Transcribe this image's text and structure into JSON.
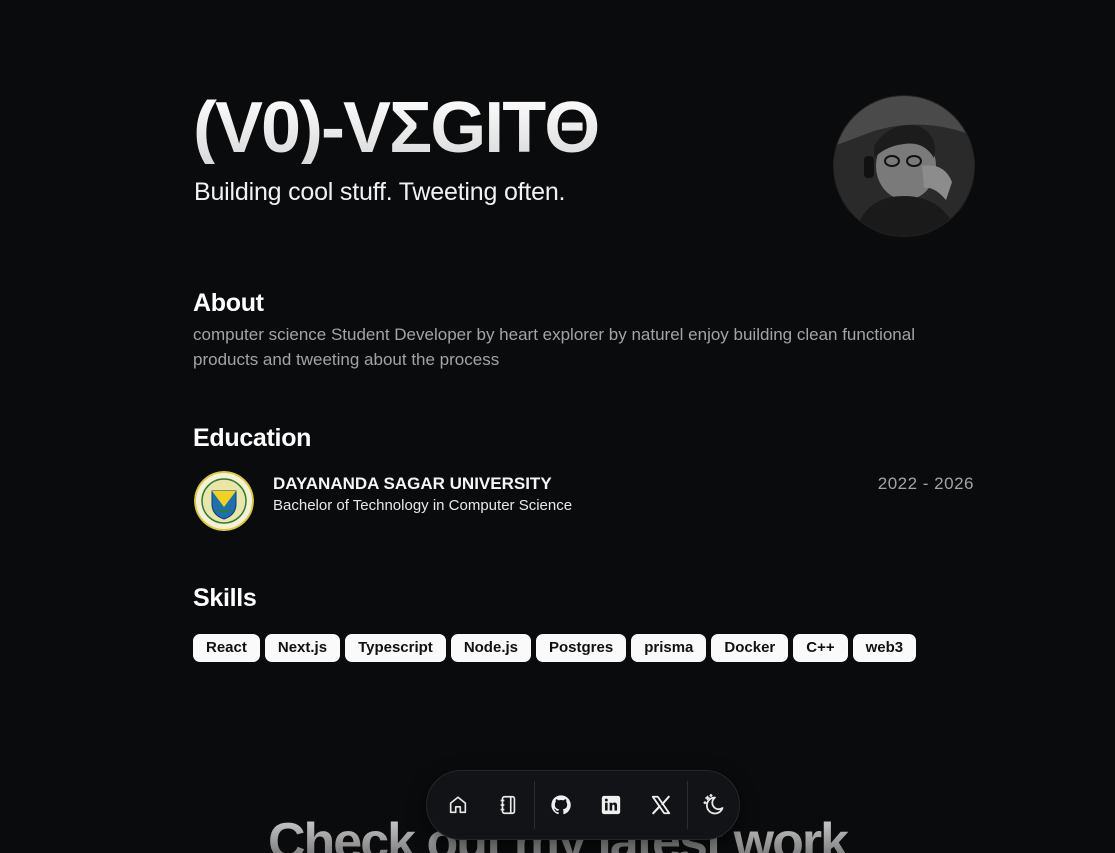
{
  "hero": {
    "name": "(V0)-VΣGITΘ",
    "tagline": "Building cool stuff. Tweeting often."
  },
  "about": {
    "heading": "About",
    "text": "computer science Student Developer by heart explorer by naturel enjoy building clean functional products and tweeting about the process"
  },
  "education": {
    "heading": "Education",
    "school": "DAYANANDA SAGAR UNIVERSITY",
    "degree": "Bachelor of Technology in Computer Science",
    "years": "2022 - 2026"
  },
  "skills": {
    "heading": "Skills",
    "items": [
      "React",
      "Next.js",
      "Typescript",
      "Node.js",
      "Postgres",
      "prisma",
      "Docker",
      "C++",
      "web3"
    ]
  },
  "cta": {
    "text": "Check out my latest work"
  },
  "dock": {
    "items": [
      "home-icon",
      "notebook-icon",
      "github-icon",
      "linkedin-icon",
      "x-icon",
      "theme-toggle-icon"
    ]
  },
  "colors": {
    "background": "#0a0b0d",
    "muted_text": "#a3a3a3",
    "pill_bg": "#fafafa"
  }
}
